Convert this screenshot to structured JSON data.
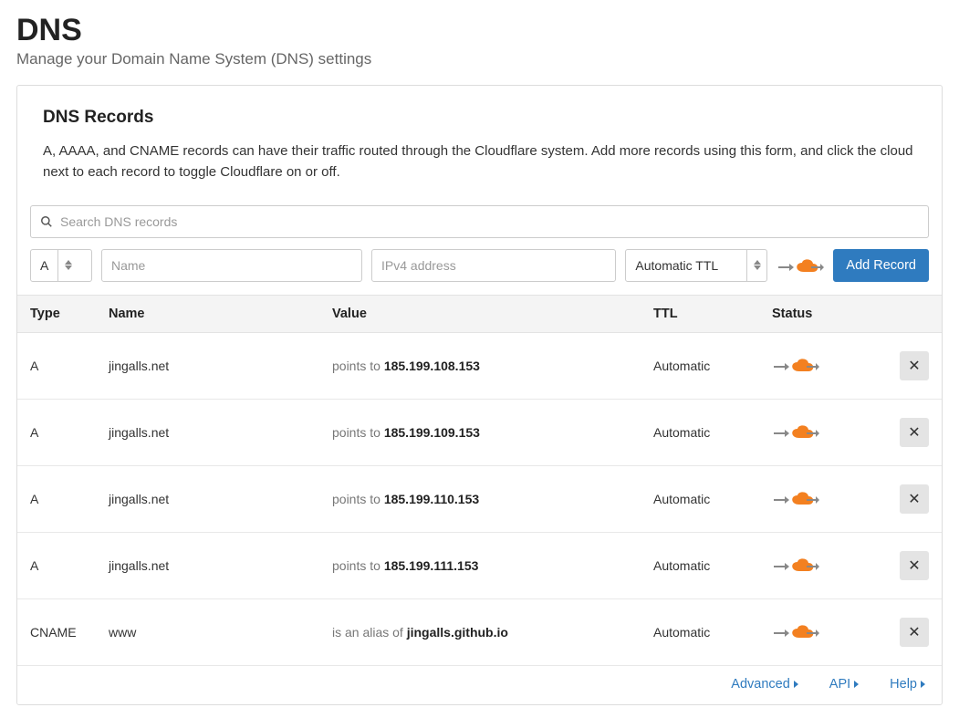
{
  "page": {
    "title": "DNS",
    "subtitle": "Manage your Domain Name System (DNS) settings"
  },
  "card": {
    "title": "DNS Records",
    "description": "A, AAAA, and CNAME records can have their traffic routed through the Cloudflare system. Add more records using this form, and click the cloud next to each record to toggle Cloudflare on or off."
  },
  "search": {
    "placeholder": "Search DNS records"
  },
  "form": {
    "type_value": "A",
    "name_placeholder": "Name",
    "value_placeholder": "IPv4 address",
    "ttl_value": "Automatic TTL",
    "add_button": "Add Record"
  },
  "table": {
    "headers": {
      "type": "Type",
      "name": "Name",
      "value": "Value",
      "ttl": "TTL",
      "status": "Status"
    },
    "rows": [
      {
        "type": "A",
        "name": "jingalls.net",
        "value_prefix": "points to ",
        "value_target": "185.199.108.153",
        "ttl": "Automatic"
      },
      {
        "type": "A",
        "name": "jingalls.net",
        "value_prefix": "points to ",
        "value_target": "185.199.109.153",
        "ttl": "Automatic"
      },
      {
        "type": "A",
        "name": "jingalls.net",
        "value_prefix": "points to ",
        "value_target": "185.199.110.153",
        "ttl": "Automatic"
      },
      {
        "type": "A",
        "name": "jingalls.net",
        "value_prefix": "points to ",
        "value_target": "185.199.111.153",
        "ttl": "Automatic"
      },
      {
        "type": "CNAME",
        "name": "www",
        "value_prefix": "is an alias of ",
        "value_target": "jingalls.github.io",
        "ttl": "Automatic"
      }
    ]
  },
  "footer": {
    "advanced": "Advanced",
    "api": "API",
    "help": "Help"
  },
  "icons": {
    "delete_glyph": "✕"
  }
}
